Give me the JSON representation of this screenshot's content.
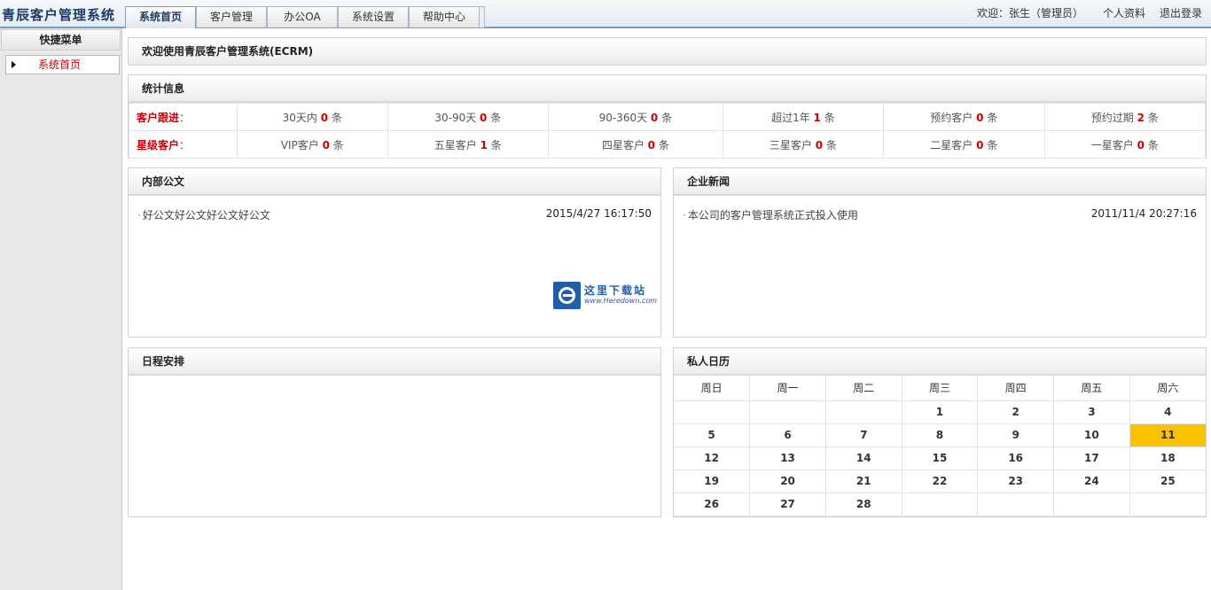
{
  "app": {
    "title": "青辰客户管理系统"
  },
  "tabs": [
    {
      "label": "系统首页",
      "active": true
    },
    {
      "label": "客户管理"
    },
    {
      "label": "办公OA"
    },
    {
      "label": "系统设置"
    },
    {
      "label": "帮助中心"
    }
  ],
  "user": {
    "welcome": "欢迎：张生（管理员）",
    "profile_link": "个人资料",
    "logout_link": "退出登录"
  },
  "sidebar": {
    "heading": "快捷菜单",
    "items": [
      {
        "label": "系统首页",
        "icon": "triangle-right-icon"
      }
    ]
  },
  "welcome_bar": {
    "text": "欢迎使用青辰客户管理系统(ECRM)"
  },
  "stats": {
    "title": "统计信息",
    "rows": [
      {
        "label": "客户跟进",
        "colon": "：",
        "cells": [
          {
            "text": "30天内",
            "value": "0",
            "unit": "条"
          },
          {
            "text": "30-90天",
            "value": "0",
            "unit": "条"
          },
          {
            "text": "90-360天",
            "value": "0",
            "unit": "条"
          },
          {
            "text": "超过1年",
            "value": "1",
            "unit": "条"
          },
          {
            "text": "预约客户",
            "value": "0",
            "unit": "条"
          },
          {
            "text": "预约过期",
            "value": "2",
            "unit": "条"
          }
        ]
      },
      {
        "label": "星级客户",
        "colon": "：",
        "cells": [
          {
            "text": "VIP客户",
            "value": "0",
            "unit": "条"
          },
          {
            "text": "五星客户",
            "value": "1",
            "unit": "条"
          },
          {
            "text": "四星客户",
            "value": "0",
            "unit": "条"
          },
          {
            "text": "三星客户",
            "value": "0",
            "unit": "条"
          },
          {
            "text": "二星客户",
            "value": "0",
            "unit": "条"
          },
          {
            "text": "一星客户",
            "value": "0",
            "unit": "条"
          }
        ]
      }
    ]
  },
  "notice": {
    "title": "内部公文",
    "items": [
      {
        "bullet": "·",
        "text": "好公文好公文好公文好公文",
        "date": "2015/4/27 16:17:50"
      }
    ],
    "watermark": {
      "cn": "这里下载站",
      "en": "www.Heredown.com",
      "color": "#1f5ea8"
    }
  },
  "news": {
    "title": "企业新闻",
    "items": [
      {
        "bullet": "·",
        "text": "本公司的客户管理系统正式投入使用",
        "date": "2011/11/4 20:27:16"
      }
    ]
  },
  "schedule": {
    "title": "日程安排"
  },
  "calendar": {
    "title": "私人日历",
    "weekdays": [
      "周日",
      "周一",
      "周二",
      "周三",
      "周四",
      "周五",
      "周六"
    ],
    "weeks": [
      [
        "",
        "",
        "",
        "1",
        "2",
        "3",
        "4"
      ],
      [
        "5",
        "6",
        "7",
        "8",
        "9",
        "10",
        "11"
      ],
      [
        "12",
        "13",
        "14",
        "15",
        "16",
        "17",
        "18"
      ],
      [
        "19",
        "20",
        "21",
        "22",
        "23",
        "24",
        "25"
      ],
      [
        "26",
        "27",
        "28",
        "",
        "",
        "",
        ""
      ]
    ],
    "today": "11",
    "today_color": "#f8c200"
  }
}
